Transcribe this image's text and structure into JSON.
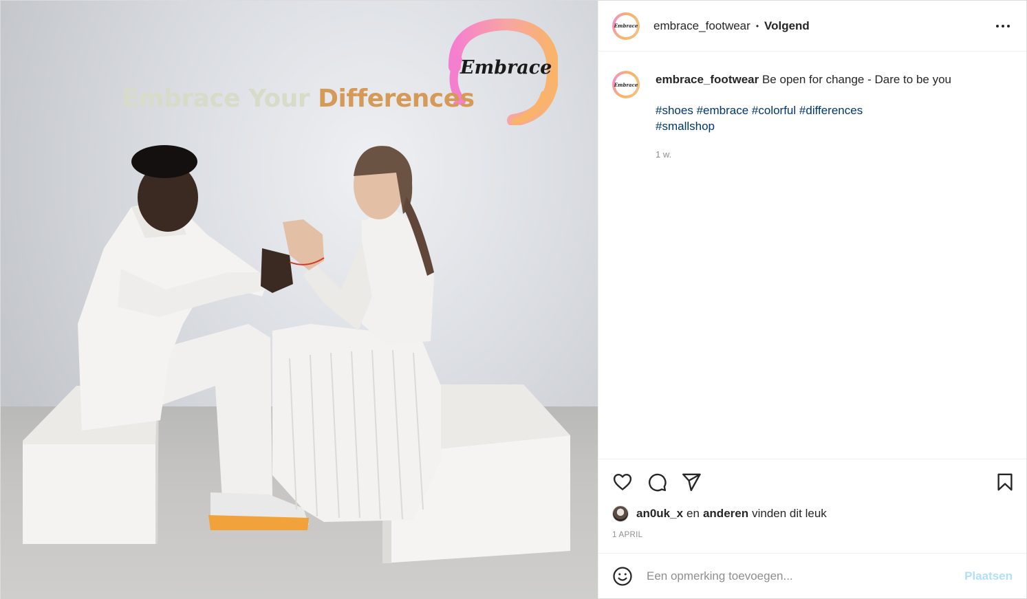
{
  "media": {
    "headline_part1": "Embrace Your",
    "headline_part2": "Differences",
    "logo_text": "Embrace"
  },
  "header": {
    "username": "embrace_footwear",
    "separator": "•",
    "follow_state": "Volgend",
    "avatar_text": "Embrace"
  },
  "caption": {
    "username": "embrace_footwear",
    "text": "Be open for change - Dare to be you",
    "hashtags_line1": [
      "#shoes",
      "#embrace",
      "#colorful",
      "#differences"
    ],
    "hashtags_line2": [
      "#smallshop"
    ],
    "time": "1 w."
  },
  "actions": {
    "like_icon": "heart-icon",
    "comment_icon": "comment-icon",
    "share_icon": "paper-plane-icon",
    "save_icon": "bookmark-icon"
  },
  "likes": {
    "user": "an0uk_x",
    "connector": "en",
    "others": "anderen",
    "suffix": "vinden dit leuk"
  },
  "date": "1 APRIL",
  "comment_box": {
    "placeholder": "Een opmerking toevoegen...",
    "post_label": "Plaatsen",
    "emoji_icon": "smiley-icon"
  },
  "colors": {
    "hashtag": "#00376b",
    "post_button_disabled": "#b2dffc",
    "headline_light": "#d6dcc7",
    "headline_accent": "#d59a58"
  }
}
